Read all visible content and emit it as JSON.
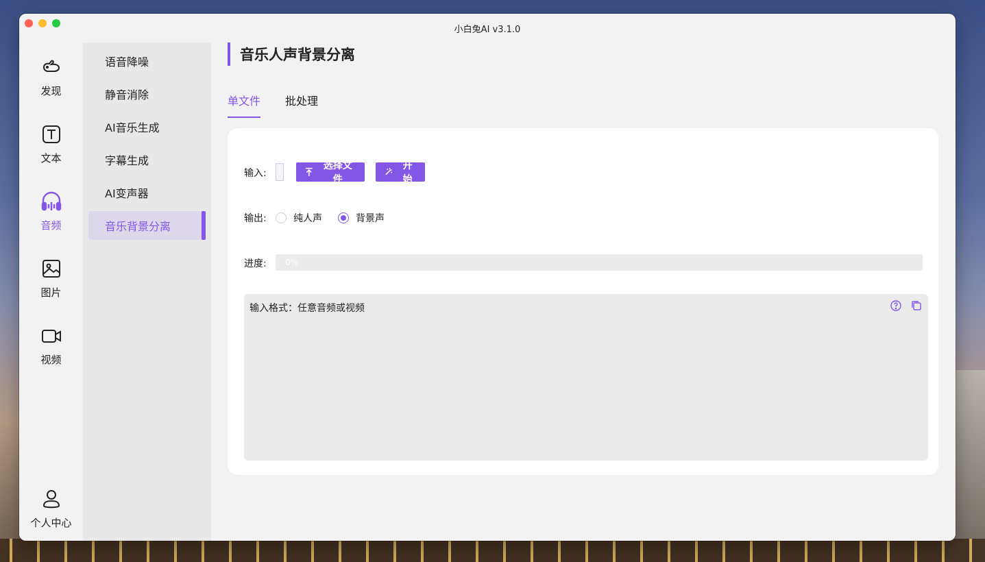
{
  "window": {
    "title": "小白兔AI v3.1.0"
  },
  "nav": {
    "items": [
      {
        "label": "发现",
        "icon": "rabbit-icon"
      },
      {
        "label": "文本",
        "icon": "text-icon"
      },
      {
        "label": "音频",
        "icon": "headphones-icon",
        "active": true
      },
      {
        "label": "图片",
        "icon": "image-icon"
      },
      {
        "label": "视频",
        "icon": "video-icon"
      }
    ],
    "user": {
      "label": "个人中心",
      "icon": "user-icon"
    }
  },
  "subnav": {
    "items": [
      {
        "label": "语音降噪"
      },
      {
        "label": "静音消除"
      },
      {
        "label": "AI音乐生成"
      },
      {
        "label": "字幕生成"
      },
      {
        "label": "AI变声器"
      },
      {
        "label": "音乐背景分离",
        "active": true
      }
    ]
  },
  "main": {
    "title": "音乐人声背景分离",
    "tabs": [
      {
        "label": "单文件",
        "active": true
      },
      {
        "label": "批处理"
      }
    ],
    "input": {
      "label": "输入:",
      "choose_file_label": "选择文件",
      "start_label": "开始"
    },
    "output": {
      "label": "输出:",
      "options": [
        {
          "label": "纯人声",
          "checked": false
        },
        {
          "label": "背景声",
          "checked": true
        }
      ]
    },
    "progress": {
      "label": "进度:",
      "value": 0,
      "text": "0%"
    },
    "log": {
      "text": "输入格式：任意音频或视频"
    }
  },
  "colors": {
    "accent": "#8456e6"
  }
}
